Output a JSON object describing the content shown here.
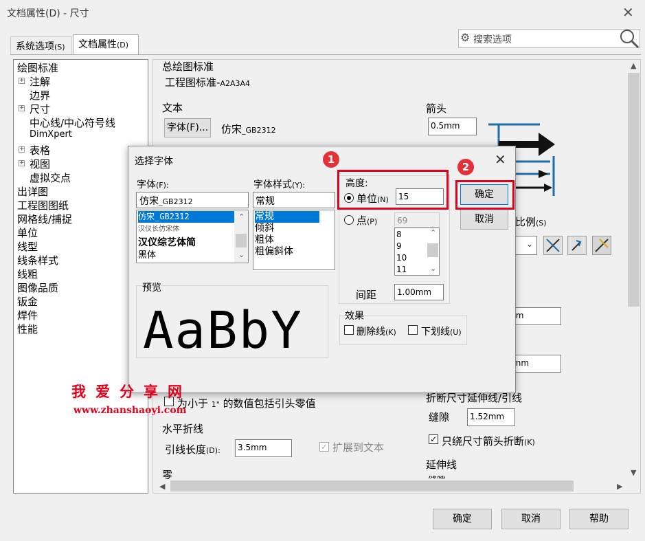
{
  "window": {
    "title": "文档属性(D) - 尺寸",
    "close": "✕"
  },
  "search": {
    "placeholder": "搜索选项"
  },
  "tabs": [
    {
      "label": "系统选项",
      "shortcut": "(S)"
    },
    {
      "label": "文档属性",
      "shortcut": "(D)"
    }
  ],
  "tree": [
    {
      "label": "绘图标准",
      "expander": false
    },
    {
      "label": "注解",
      "expander": true
    },
    {
      "label": "边界",
      "expander": false
    },
    {
      "label": "尺寸",
      "expander": true
    },
    {
      "label": "中心线/中心符号线",
      "expander": false
    },
    {
      "label": "DimXpert",
      "expander": false
    },
    {
      "label": "表格",
      "expander": true
    },
    {
      "label": "视图",
      "expander": true
    },
    {
      "label": "虚拟交点",
      "expander": false
    },
    {
      "label": "出详图",
      "expander": false
    },
    {
      "label": "工程图图纸",
      "expander": false
    },
    {
      "label": "网格线/捕捉",
      "expander": false
    },
    {
      "label": "单位",
      "expander": false
    },
    {
      "label": "线型",
      "expander": false
    },
    {
      "label": "线条样式",
      "expander": false
    },
    {
      "label": "线粗",
      "expander": false
    },
    {
      "label": "图像品质",
      "expander": false
    },
    {
      "label": "钣金",
      "expander": false
    },
    {
      "label": "焊件",
      "expander": false
    },
    {
      "label": "性能",
      "expander": false
    }
  ],
  "content": {
    "overall_standard_title": "总绘图标准",
    "overall_standard_value": "工程图标准-",
    "overall_standard_suffix": "A2A3A4",
    "text_title": "文本",
    "font_button": "字体(F)...",
    "font_value": "仿宋",
    "font_value_suffix": "_GB2312",
    "arrow_title": "箭头",
    "arrow_value": "0.5mm",
    "scale_label": "比例",
    "scale_shortcut": "(S)",
    "field_a": "mm",
    "field_b": "0mm",
    "leading_zero_prefix": "为小于 ",
    "leading_zero_unit": "1\"",
    "leading_zero_suffix": " 的数值包括引头零值",
    "horizontal_title": "水平折线",
    "leader_length_label": "引线长度",
    "leader_length_shortcut": "(D):",
    "leader_length_value": "3.5mm",
    "extend_to_text": "扩展到文本",
    "zero_title": "零",
    "break_title": "折断尺寸延伸线/引线",
    "gap_label": "缝隙",
    "gap_value": "1.52mm",
    "only_arrow_label": "只绕尺寸箭头折断",
    "only_arrow_shortcut": "(K)",
    "extension_title": "延伸线",
    "extension_gap": "缝隙"
  },
  "footer": {
    "ok": "确定",
    "cancel": "取消",
    "help": "帮助"
  },
  "dialog": {
    "title": "选择字体",
    "close": "✕",
    "font_label": "字体",
    "font_shortcut": "(F):",
    "font_value": "仿宋",
    "font_value_suffix": "_GB2312",
    "fonts": [
      "仿宋_GB2312",
      "汉仪长仿宋体",
      "汉仪综艺体简",
      "黑体"
    ],
    "style_label": "字体样式",
    "style_shortcut": "(Y):",
    "style_value": "常规",
    "styles": [
      "常规",
      "倾斜",
      "粗体",
      "粗偏斜体"
    ],
    "height_label": "高度:",
    "unit_label": "单位",
    "unit_shortcut": "(N)",
    "unit_value": "15",
    "point_label": "点",
    "point_shortcut": "(P)",
    "point_value": "69",
    "sizes": [
      "8",
      "9",
      "10",
      "11"
    ],
    "spacing_label": "间距",
    "spacing_value": "1.00mm",
    "effects_label": "效果",
    "strike_label": "删除线",
    "strike_shortcut": "(K)",
    "underline_label": "下划线",
    "underline_shortcut": "(U)",
    "preview_label": "预览",
    "preview_text": "AaBbY",
    "ok": "确定",
    "cancel": "取消"
  },
  "badges": [
    "1",
    "2"
  ],
  "watermark": {
    "cn": "我爱分享网",
    "url": "www.zhanshaoyi.com"
  },
  "colors": {
    "highlight": "#e3001b",
    "selection": "#0078d7",
    "badge": "#e3313a"
  }
}
